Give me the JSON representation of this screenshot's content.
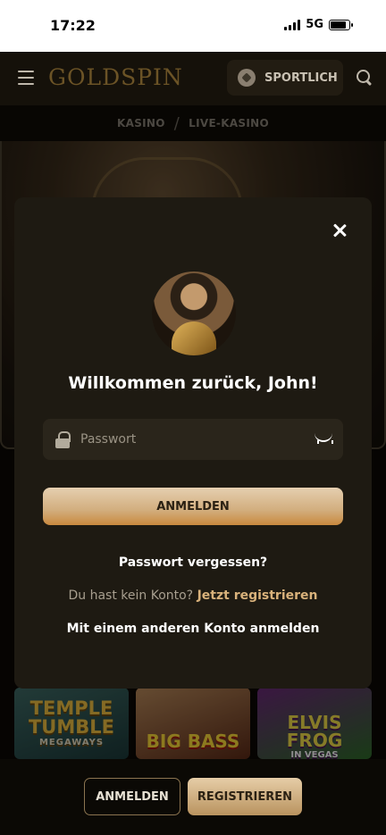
{
  "status_bar": {
    "time": "17:22",
    "network": "5G"
  },
  "header": {
    "logo": "GOLDSPIN",
    "sport_label": "SPORTLICH"
  },
  "breadcrumb": {
    "items": [
      "KASINO",
      "LIVE-KASINO"
    ],
    "separator": "/"
  },
  "modal": {
    "title": "Willkommen zurück, John!",
    "password_placeholder": "Passwort",
    "login_label": "ANMELDEN",
    "forgot_label": "Passwort vergessen?",
    "no_account_text": "Du hast kein Konto?",
    "register_link": "Jetzt registrieren",
    "other_account_label": "Mit einem anderen Konto anmelden"
  },
  "games": [
    {
      "title": "TEMPLE TUMBLE",
      "subtitle": "MEGAWAYS"
    },
    {
      "title": "BIG BASS",
      "subtitle": ""
    },
    {
      "title": "ELVIS FROG",
      "subtitle": "IN VEGAS"
    }
  ],
  "bottom_bar": {
    "login_label": "ANMELDEN",
    "register_label": "REGISTRIEREN"
  },
  "colors": {
    "accent_gold": "#d9b27b",
    "modal_bg": "#1e1a12",
    "page_bg": "#0b0905"
  }
}
